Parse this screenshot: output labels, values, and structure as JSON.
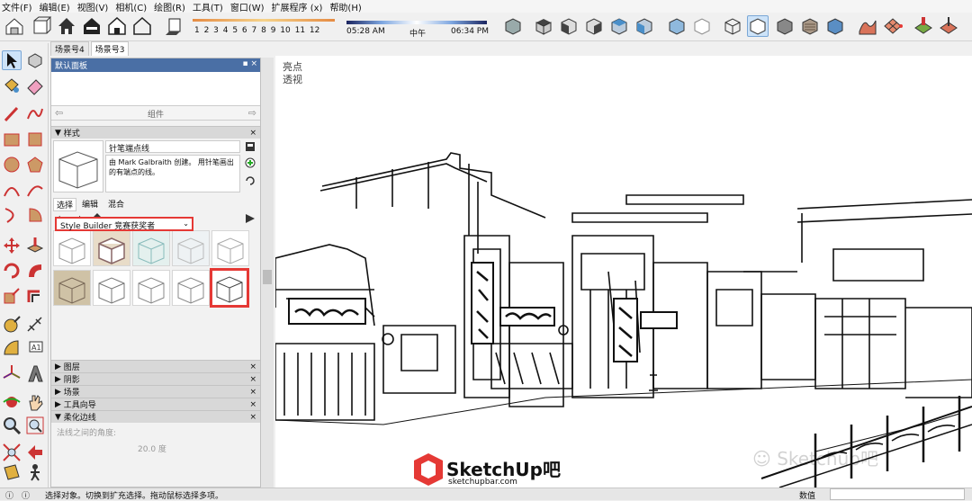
{
  "menu": [
    "文件(F)",
    "编辑(E)",
    "视图(V)",
    "相机(C)",
    "绘图(R)",
    "工具(T)",
    "窗口(W)",
    "扩展程序 (x)",
    "帮助(H)"
  ],
  "sun": {
    "months": "1 2 3 4 5 6 7 8 9 10 11 12"
  },
  "time": {
    "start": "05:28 AM",
    "mid": "中午",
    "end": "06:34 PM"
  },
  "scene_tabs": [
    "场景号4",
    "场景号3"
  ],
  "panel": {
    "title": "默认面板",
    "components_label": "组件",
    "styles_header": "样式",
    "style_name": "针笔端点线",
    "style_desc": "由 Mark Galbraith 创建。 用针笔画出的有端点的线。",
    "style_tabs": [
      "选择",
      "编辑",
      "混合"
    ],
    "collection": "Style Builder 竞赛获奖者",
    "sections": [
      "图层",
      "阴影",
      "场景",
      "工具向导",
      "柔化边线"
    ],
    "soft_edges_label": "法线之间的角度:",
    "soft_edges_value": "20.0 度"
  },
  "viewport": {
    "label1": "亮点",
    "label2": "透视"
  },
  "status": {
    "text": "选择对象。切换到扩充选择。拖动鼠标选择多项。",
    "value_label": "数值"
  },
  "watermark": {
    "brand": "SketchUp吧",
    "url": "sketchupbar.com",
    "corner": "Sketchup吧"
  },
  "colors": {
    "accent_red": "#e53935",
    "panel_title": "#4a6fa5",
    "selected_blue": "#cde3f8"
  }
}
